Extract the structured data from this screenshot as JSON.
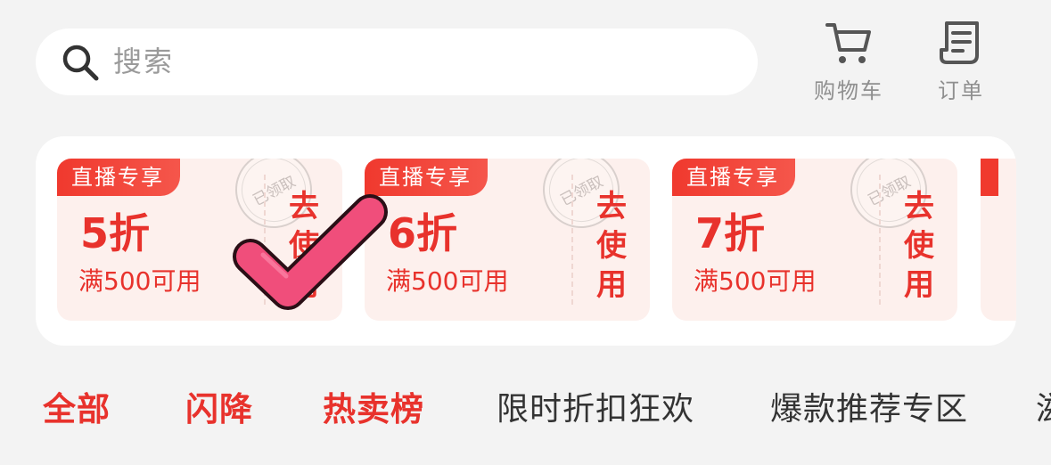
{
  "search": {
    "placeholder": "搜索"
  },
  "top_actions": [
    {
      "label": "购物车",
      "icon": "cart-icon"
    },
    {
      "label": "订单",
      "icon": "order-icon"
    }
  ],
  "coupons": [
    {
      "tag": "直播专享",
      "discount": "5折",
      "condition": "满500可用",
      "action": "去使用",
      "stamp": "已领取"
    },
    {
      "tag": "直播专享",
      "discount": "6折",
      "condition": "满500可用",
      "action": "去使用",
      "stamp": "已领取"
    },
    {
      "tag": "直播专享",
      "discount": "7折",
      "condition": "满500可用",
      "action": "去使用",
      "stamp": "已领取"
    }
  ],
  "tabs": [
    {
      "label": "全部",
      "active": true
    },
    {
      "label": "闪降"
    },
    {
      "label": "热卖榜"
    },
    {
      "label": "限时折扣狂欢"
    },
    {
      "label": "爆款推荐专区"
    },
    {
      "label": "滋"
    }
  ],
  "colors": {
    "accent": "#e8322c",
    "background": "#f3f3f3",
    "coupon_bg": "#fdf0ed",
    "check": "#f04e7b"
  }
}
